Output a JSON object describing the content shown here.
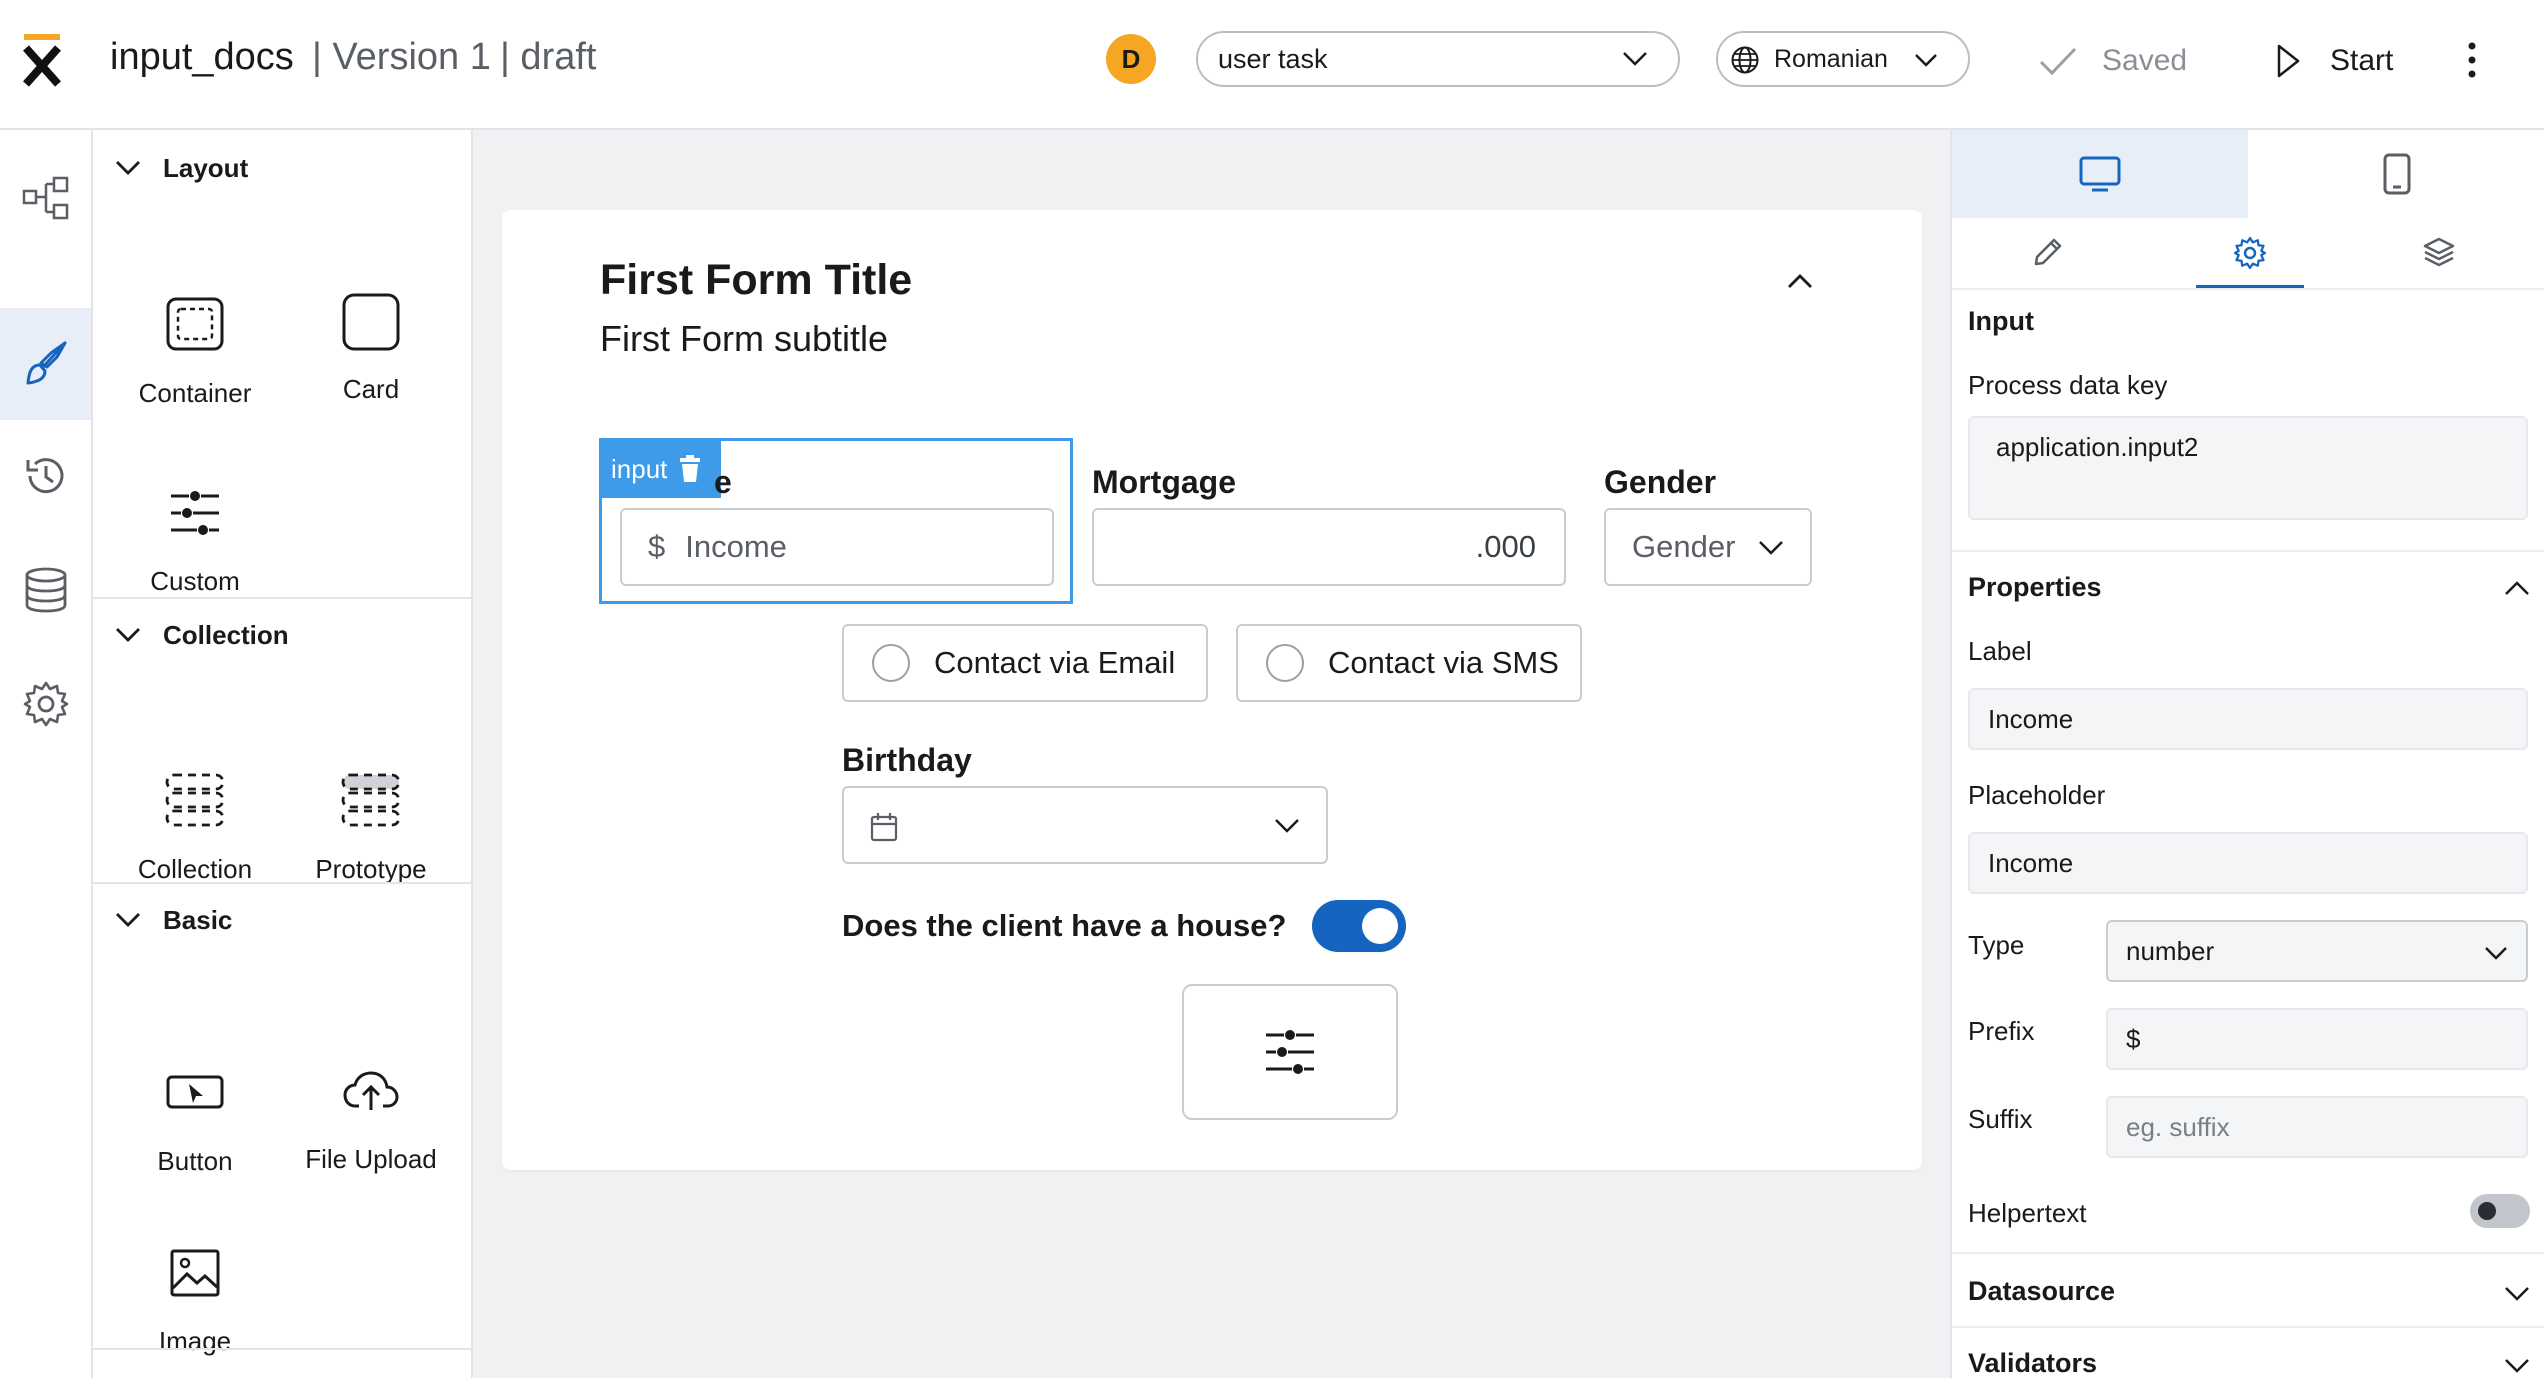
{
  "app": {
    "logo": "x-logo",
    "title": "input_docs",
    "version": "| Version 1",
    "status": "| draft"
  },
  "header": {
    "avatar_initial": "D",
    "task_select": "user task",
    "language": "Romanian",
    "saved_label": "Saved",
    "start_label": "Start"
  },
  "rail": [
    "process-icon",
    "brush-icon",
    "history-icon",
    "database-icon",
    "gear-icon"
  ],
  "palette": {
    "layout": {
      "title": "Layout",
      "items": [
        "Container",
        "Card",
        "Custom"
      ]
    },
    "collection": {
      "title": "Collection",
      "items": [
        "Collection",
        "Prototype"
      ]
    },
    "basic": {
      "title": "Basic",
      "items": [
        "Button",
        "File Upload",
        "Image"
      ]
    }
  },
  "form": {
    "title": "First Form Title",
    "subtitle": "First Form subtitle",
    "selected_tag": "input",
    "income": {
      "label_tail": "e",
      "prefix": "$",
      "placeholder": "Income"
    },
    "mortgage": {
      "label": "Mortgage",
      "value": ".000"
    },
    "gender": {
      "label": "Gender",
      "value": "Gender"
    },
    "radio_email": "Contact via Email",
    "radio_sms": "Contact via SMS",
    "birthday": {
      "label": "Birthday"
    },
    "house": {
      "label": "Does the client have a house?",
      "on": true
    }
  },
  "panel": {
    "section": "Input",
    "process_key_label": "Process data key",
    "process_key_value": "application.input2",
    "properties": "Properties",
    "label_label": "Label",
    "label_value": "Income",
    "placeholder_label": "Placeholder",
    "placeholder_value": "Income",
    "type_label": "Type",
    "type_value": "number",
    "prefix_label": "Prefix",
    "prefix_value": "$",
    "suffix_label": "Suffix",
    "suffix_placeholder": "eg. suffix",
    "helpertext_label": "Helpertext",
    "helpertext_on": false,
    "datasource": "Datasource",
    "validators": "Validators"
  },
  "colors": {
    "accent": "#1565c0",
    "selection": "#3d9be9",
    "avatar": "#f5a623"
  }
}
